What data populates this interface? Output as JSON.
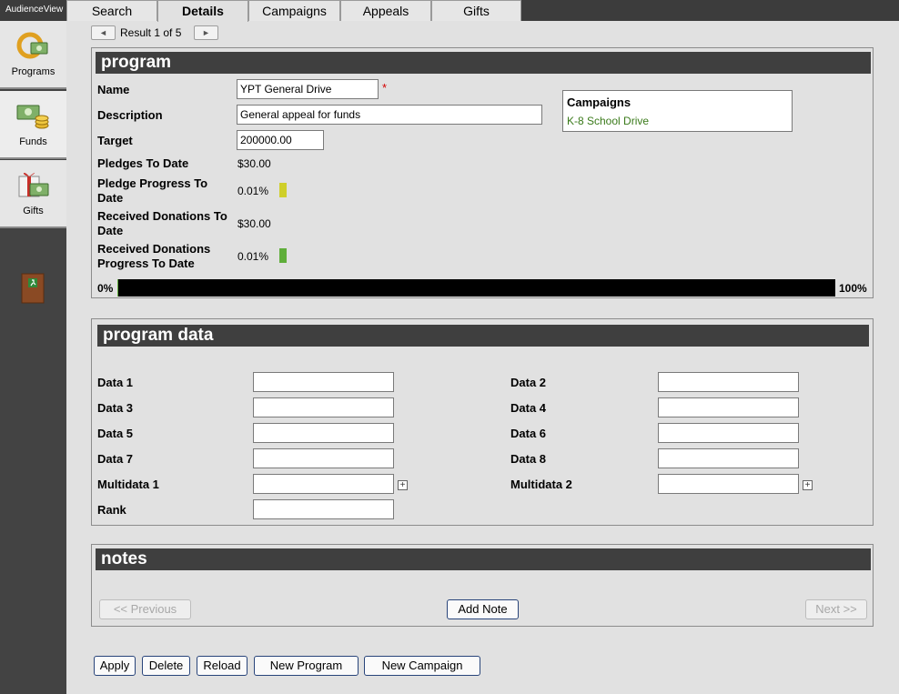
{
  "app": {
    "brand": "AudienceView"
  },
  "tabs": [
    {
      "label": "Search"
    },
    {
      "label": "Details"
    },
    {
      "label": "Campaigns"
    },
    {
      "label": "Appeals"
    },
    {
      "label": "Gifts"
    }
  ],
  "sidebar": {
    "items": [
      {
        "label": "Programs",
        "icon": "programs-icon"
      },
      {
        "label": "Funds",
        "icon": "funds-icon"
      },
      {
        "label": "Gifts",
        "icon": "gifts-icon"
      }
    ],
    "exit_icon": "exit-door-icon"
  },
  "pager": {
    "text": "Result 1 of 5",
    "prev_glyph": "◄",
    "next_glyph": "►"
  },
  "program": {
    "header": "program",
    "name_label": "Name",
    "name_value": "YPT General Drive",
    "required_mark": "*",
    "description_label": "Description",
    "description_value": "General appeal for funds",
    "target_label": "Target",
    "target_value": "200000.00",
    "pledges_label": "Pledges To Date",
    "pledges_value": "$30.00",
    "pledge_progress_label_1": "Pledge Progress To",
    "pledge_progress_label_2": "Date",
    "pledge_progress_value": "0.01%",
    "received_label_1": "Received Donations To",
    "received_label_2": "Date",
    "received_value": "$30.00",
    "received_progress_label_1": "Received Donations",
    "received_progress_label_2": "Progress To Date",
    "received_progress_value": "0.01%",
    "bar_min": "0%",
    "bar_max": "100%",
    "progress_fraction": 0.0001,
    "colors": {
      "pledge_swatch": "#cfcf2a",
      "received_swatch": "#5fae3a"
    },
    "campaigns_title": "Campaigns",
    "campaigns": [
      "K-8 School Drive"
    ]
  },
  "program_data": {
    "header": "program data",
    "fields": {
      "data1": "Data 1",
      "data2": "Data 2",
      "data3": "Data 3",
      "data4": "Data 4",
      "data5": "Data 5",
      "data6": "Data 6",
      "data7": "Data 7",
      "data8": "Data 8",
      "multi1": "Multidata 1",
      "multi2": "Multidata 2",
      "rank": "Rank"
    },
    "plus_glyph": "+"
  },
  "notes": {
    "header": "notes",
    "previous": "<< Previous",
    "add_note": "Add Note",
    "next": "Next >>"
  },
  "actions": {
    "apply": "Apply",
    "delete": "Delete",
    "reload": "Reload",
    "new_program": "New Program",
    "new_campaign": "New Campaign"
  }
}
